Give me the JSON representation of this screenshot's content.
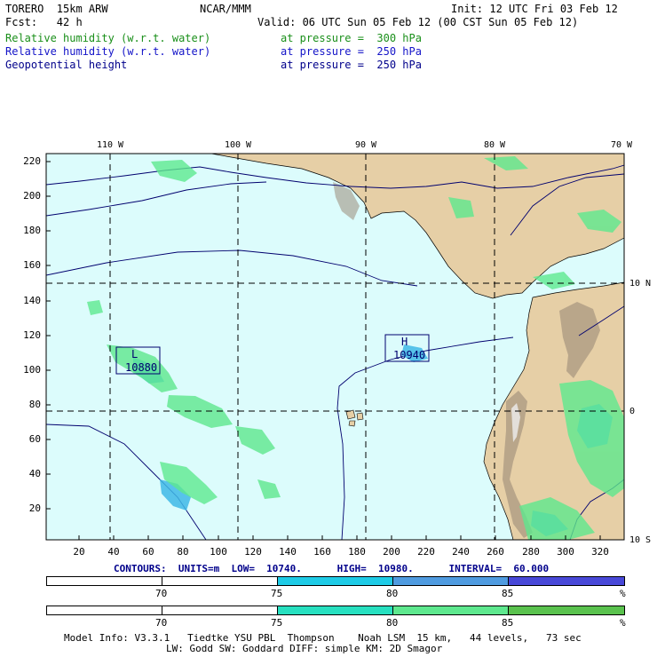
{
  "header": {
    "model": "TORERO  15km ARW",
    "center": "NCAR/MMM",
    "init": "Init: 12 UTC Fri 03 Feb 12",
    "fcst": "Fcst:   42 h",
    "valid": "Valid: 06 UTC Sun 05 Feb 12 (00 CST Sun 05 Feb 12)",
    "fields": [
      {
        "name": "Relative humidity (w.r.t. water)",
        "level": "at pressure =  300 hPa",
        "color": "#1a8f1a"
      },
      {
        "name": "Relative humidity (w.r.t. water)",
        "level": "at pressure =  250 hPa",
        "color": "#1414c8"
      },
      {
        "name": "Geopotential height",
        "level": "at pressure =  250 hPa",
        "color": "#00008b"
      }
    ]
  },
  "map": {
    "top_lon_labels": [
      "110 W",
      "100 W",
      "90 W",
      "80 W",
      "70 W"
    ],
    "right_lat_labels": [
      "10 N",
      "0",
      "10 S"
    ],
    "left_y_ticks": [
      "220",
      "200",
      "180",
      "160",
      "140",
      "120",
      "100",
      "80",
      "60",
      "40",
      "20"
    ],
    "bottom_x_ticks": [
      "20",
      "40",
      "60",
      "80",
      "100",
      "120",
      "140",
      "160",
      "180",
      "200",
      "220",
      "240",
      "260",
      "280",
      "300",
      "320"
    ],
    "centers": [
      {
        "symbol": "L",
        "value": "10880"
      },
      {
        "symbol": "H",
        "value": "10940"
      }
    ],
    "colors": {
      "ocean": "#dcfcfc",
      "land": "#e6cfa6",
      "terrain": "#9b8b78",
      "contour": "#00006e"
    }
  },
  "contour_info": "CONTOURS:  UNITS=m  LOW=  10740.      HIGH=  10980.      INTERVAL=  60.000",
  "colorbar_250": {
    "labels": [
      "70",
      "75",
      "80",
      "85",
      "%"
    ],
    "colors": [
      "#ffffff",
      "#ffffff",
      "#1ecbe6",
      "#4f9be0",
      "#4848d8"
    ]
  },
  "colorbar_300": {
    "labels": [
      "70",
      "75",
      "80",
      "85",
      "%"
    ],
    "colors": [
      "#ffffff",
      "#ffffff",
      "#27e0c0",
      "#5ee88e",
      "#5ac24e"
    ]
  },
  "footer": {
    "line1": "Model Info: V3.3.1   Tiedtke YSU PBL  Thompson    Noah LSM  15 km,   44 levels,   73 sec",
    "line2": "LW: Godd SW: Goddard DIFF: simple KM: 2D Smagor"
  }
}
